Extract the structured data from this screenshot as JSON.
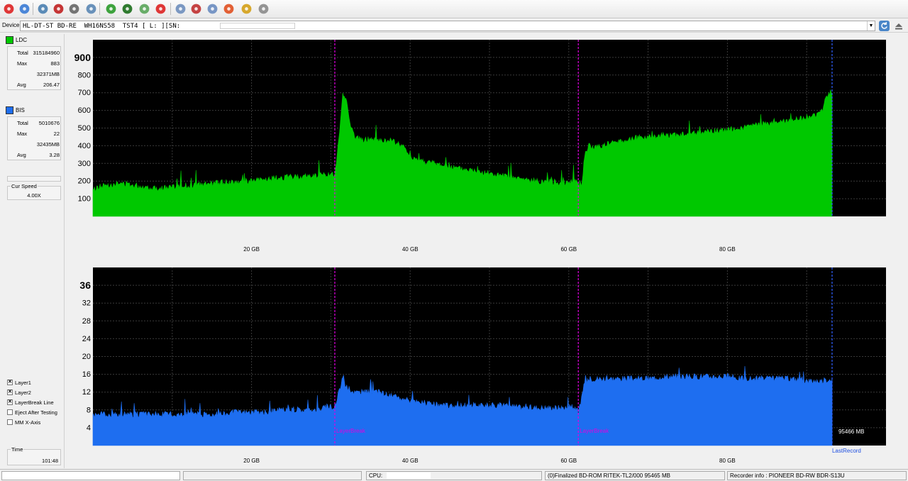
{
  "toolbar": {
    "buttons": [
      {
        "name": "exit-icon",
        "color": "#d22"
      },
      {
        "name": "drive-info-icon",
        "color": "#3a7bd5"
      },
      {
        "name": "benchmark-icon",
        "color": "#4a7fb0"
      },
      {
        "name": "create-disc-icon",
        "color": "#c02020"
      },
      {
        "name": "erase-disc-icon",
        "color": "#666"
      },
      {
        "name": "disc-copy-icon",
        "color": "#5a86b4"
      },
      {
        "name": "start-icon",
        "color": "#2a9a2a"
      },
      {
        "name": "scan-disc-icon",
        "color": "#1b6e1b"
      },
      {
        "name": "refresh-icon",
        "color": "#5aa55a"
      },
      {
        "name": "stop-icon",
        "color": "#d22"
      },
      {
        "name": "disc-quality-icon",
        "color": "#6e8ebc"
      },
      {
        "name": "disc-info-icon",
        "color": "#c03030"
      },
      {
        "name": "burn-disc-icon",
        "color": "#6a8cc0"
      },
      {
        "name": "fire-icon",
        "color": "#e05020"
      },
      {
        "name": "report-icon",
        "color": "#d4a017"
      },
      {
        "name": "printer-icon",
        "color": "#8a8a8a"
      }
    ]
  },
  "device": {
    "label": "Device:",
    "text": "HL-DT-ST BD-RE  WH16NS58  TST4 [ L: ][SN:              ]"
  },
  "legend": {
    "ldc": {
      "label": "LDC",
      "color": "#00c800",
      "total_label": "Total",
      "total": "315184960",
      "max_label": "Max",
      "max": "883",
      "mb": "32371MB",
      "avg_label": "Avg",
      "avg": "206.47"
    },
    "bis": {
      "label": "BIS",
      "color": "#1e6ef0",
      "total_label": "Total",
      "total": "5010676",
      "max_label": "Max",
      "max": "22",
      "mb": "32435MB",
      "avg_label": "Avg",
      "avg": "3.28"
    }
  },
  "speed": {
    "label": "Cur Speed",
    "value": "4.00X"
  },
  "time": {
    "label": "Time",
    "value": "101:48"
  },
  "options": [
    {
      "label": "Layer1",
      "checked": true
    },
    {
      "label": "Layer2",
      "checked": true
    },
    {
      "label": "LayerBreak Line",
      "checked": true
    },
    {
      "label": "Eject After Testing",
      "checked": false
    },
    {
      "label": "MM X-Axis",
      "checked": false
    }
  ],
  "status": {
    "cpu_label": "CPU:",
    "disc": "(0)Finalized  BD-ROM  RITEK-TL2/000  95465 MB",
    "recorder": "Recorder info : PIONEER      BD-RW   BDR-S13U"
  },
  "chart_data": [
    {
      "type": "area",
      "series": [
        {
          "name": "LDC",
          "color": "#00c800"
        }
      ],
      "x_unit": "GB",
      "xlim": [
        0,
        100
      ],
      "ylim": [
        0,
        1000
      ],
      "x_ticks": [
        20,
        40,
        60,
        80
      ],
      "x_tick_labels": [
        "20 GB",
        "40 GB",
        "60 GB",
        "80 GB"
      ],
      "y_ticks": [
        100,
        200,
        300,
        400,
        500,
        600,
        700,
        800,
        900
      ],
      "y_tick_labels": [
        "100",
        "200",
        "300",
        "400",
        "500",
        "600",
        "700",
        "800",
        "900"
      ],
      "layer_breaks": [
        30.5,
        61.2
      ],
      "last_record": 93.2,
      "x": [
        0,
        1,
        2,
        4,
        6,
        8,
        10,
        12,
        14,
        16,
        18,
        20,
        22,
        24,
        26,
        28,
        30,
        30.5,
        31,
        31.5,
        32,
        32.5,
        33,
        34,
        35,
        36,
        38,
        39,
        40,
        41,
        42,
        43,
        44,
        46,
        48,
        50,
        52,
        54,
        56,
        58,
        60,
        61,
        61.2,
        61.6,
        62,
        62.5,
        63,
        64,
        66,
        68,
        70,
        72,
        74,
        76,
        78,
        80,
        82,
        84,
        86,
        88,
        90,
        91,
        92,
        92.5,
        93,
        93.2
      ],
      "values": [
        150,
        170,
        180,
        185,
        170,
        160,
        165,
        175,
        180,
        190,
        195,
        200,
        210,
        220,
        225,
        230,
        240,
        230,
        430,
        700,
        650,
        520,
        450,
        430,
        440,
        430,
        420,
        400,
        340,
        320,
        310,
        300,
        290,
        270,
        260,
        240,
        225,
        210,
        200,
        195,
        190,
        210,
        180,
        170,
        340,
        400,
        390,
        400,
        420,
        440,
        450,
        460,
        460,
        470,
        480,
        490,
        500,
        520,
        530,
        540,
        560,
        570,
        600,
        680,
        700,
        690
      ]
    },
    {
      "type": "area",
      "series": [
        {
          "name": "BIS",
          "color": "#1e6ef0"
        }
      ],
      "x_unit": "GB",
      "xlim": [
        0,
        100
      ],
      "ylim": [
        0,
        40
      ],
      "x_ticks": [
        20,
        40,
        60,
        80
      ],
      "x_tick_labels": [
        "20 GB",
        "40 GB",
        "60 GB",
        "80 GB"
      ],
      "y_ticks": [
        4,
        8,
        12,
        16,
        20,
        24,
        28,
        32,
        36
      ],
      "y_tick_labels": [
        "4",
        "8",
        "12",
        "16",
        "20",
        "24",
        "28",
        "32",
        "36"
      ],
      "layer_breaks": [
        30.5,
        61.2
      ],
      "last_record": 93.2,
      "layer_break_label": "LayerBreak",
      "last_record_label": "LastRecord",
      "size_annotation": "95466 MB",
      "x": [
        0,
        2,
        4,
        6,
        8,
        10,
        12,
        14,
        16,
        18,
        20,
        22,
        24,
        26,
        28,
        30,
        30.5,
        31,
        31.5,
        32,
        33,
        34,
        36,
        38,
        40,
        42,
        44,
        46,
        48,
        50,
        52,
        54,
        56,
        58,
        60,
        61,
        61.2,
        62,
        62.5,
        63,
        64,
        66,
        68,
        70,
        72,
        74,
        76,
        78,
        80,
        82,
        84,
        86,
        88,
        90,
        92,
        93.2
      ],
      "values": [
        7,
        7,
        7,
        7,
        7,
        7,
        7,
        7,
        7,
        7.5,
        7.5,
        7.5,
        8,
        8,
        8,
        9,
        8,
        12,
        15,
        13,
        12,
        12,
        12,
        11,
        10,
        9.5,
        9,
        9,
        9,
        9,
        9,
        8.5,
        8.5,
        8.5,
        8.5,
        8.5,
        7,
        14,
        15,
        15,
        15,
        15,
        15,
        15,
        15.5,
        15.5,
        15.5,
        15.5,
        15.5,
        15,
        15,
        15,
        15,
        14.5,
        14.5,
        15
      ]
    }
  ]
}
